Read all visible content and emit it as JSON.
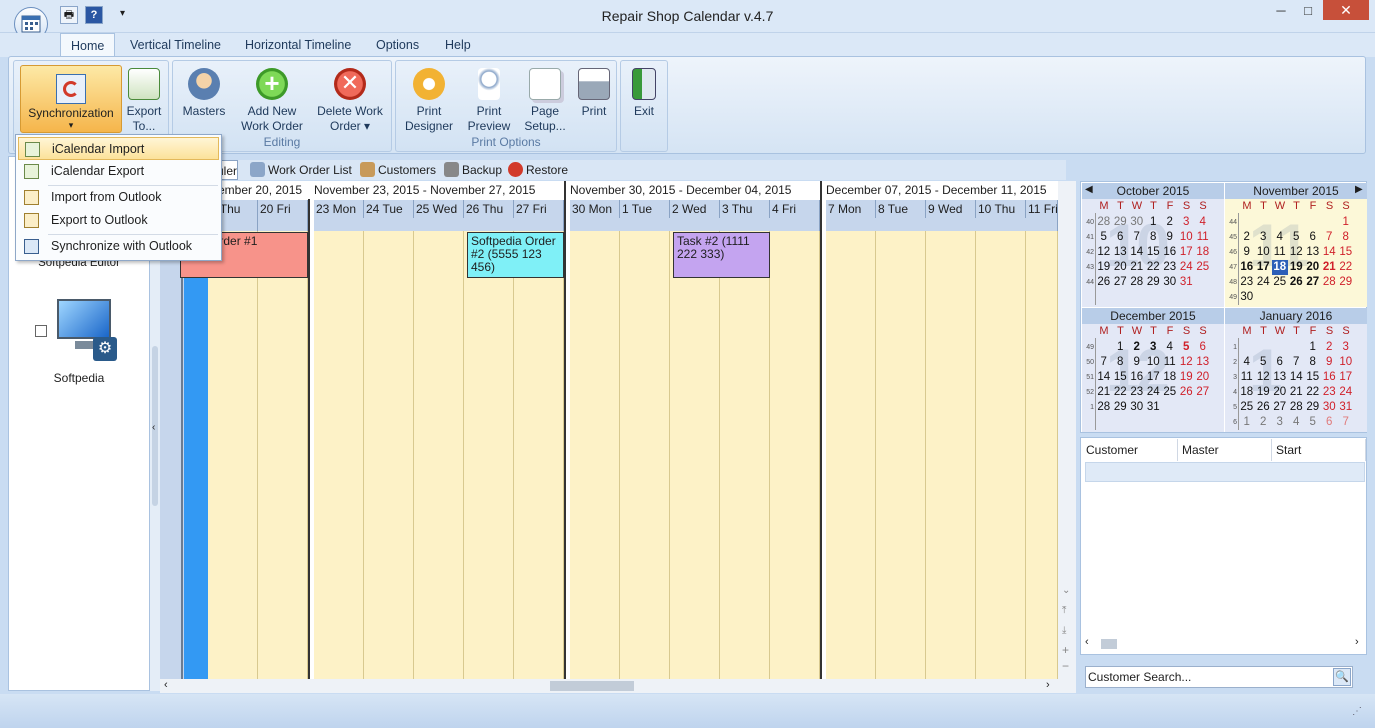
{
  "app": {
    "title": "Repair Shop Calendar v.4.7"
  },
  "window": {
    "minimize": "─",
    "maximize": "□",
    "close": "✕"
  },
  "ribbon_tabs": [
    "Home",
    "Vertical Timeline",
    "Horizontal Timeline",
    "Options",
    "Help"
  ],
  "ribbon": {
    "sync": {
      "label": "Synchronization",
      "arrow": "▾"
    },
    "export": {
      "label1": "Export",
      "label2": "To..."
    },
    "masters": {
      "label": "Masters"
    },
    "add_wo": {
      "label1": "Add New",
      "label2": "Work Order"
    },
    "delete_wo": {
      "label1": "Delete Work",
      "label2": "Order ▾"
    },
    "editing_group": "Editing",
    "print_designer": {
      "label1": "Print",
      "label2": "Designer"
    },
    "print_preview": {
      "label1": "Print",
      "label2": "Preview"
    },
    "page_setup": {
      "label1": "Page",
      "label2": "Setup..."
    },
    "print": {
      "label": "Print"
    },
    "print_group": "Print Options",
    "exit": {
      "label": "Exit"
    }
  },
  "sync_menu": [
    "iCalendar Import",
    "iCalendar Export",
    "Import from Outlook",
    "Export to Outlook",
    "Synchronize with Outlook"
  ],
  "left_panel": {
    "item1": "Softpedia Editor",
    "item2": "Softpedia"
  },
  "page_tabs": [
    "uler",
    "Work Order List",
    "Customers",
    "Backup",
    "Restore"
  ],
  "weeks": [
    {
      "range": "vember 20, 2015",
      "days": [
        "9 Thu",
        "20 Fri"
      ]
    },
    {
      "range": "November 23, 2015 - November 27, 2015",
      "days": [
        "23 Mon",
        "24 Tue",
        "25 Wed",
        "26 Thu",
        "27 Fri"
      ]
    },
    {
      "range": "November 30, 2015 - December 04, 2015",
      "days": [
        "30 Mon",
        "1 Tue",
        "2 Wed",
        "3 Thu",
        "4 Fri"
      ]
    },
    {
      "range": "December 07, 2015 - December 11, 2015",
      "days": [
        "7 Mon",
        "8 Tue",
        "9 Wed",
        "10 Thu",
        "11 Fri"
      ]
    }
  ],
  "appointments": [
    {
      "text": "edia Order #1",
      "color": "#f7938a"
    },
    {
      "text": "Softpedia Order #2 (5555 123 456)",
      "color": "#7ff0f7"
    },
    {
      "text": "Task #2 (1111 222 333)",
      "color": "#c4a4f0"
    }
  ],
  "calendars": [
    {
      "title": "October 2015",
      "big": "10",
      "dow": [
        "M",
        "T",
        "W",
        "T",
        "F",
        "S",
        "S"
      ],
      "weeks": [
        "40",
        "41",
        "42",
        "43",
        "44"
      ],
      "rows": [
        [
          "28",
          "29",
          "30",
          "1",
          "2",
          "3",
          "4"
        ],
        [
          "5",
          "6",
          "7",
          "8",
          "9",
          "10",
          "11"
        ],
        [
          "12",
          "13",
          "14",
          "15",
          "16",
          "17",
          "18"
        ],
        [
          "19",
          "20",
          "21",
          "22",
          "23",
          "24",
          "25"
        ],
        [
          "26",
          "27",
          "28",
          "29",
          "30",
          "31",
          ""
        ]
      ]
    },
    {
      "title": "November 2015",
      "big": "11",
      "dow": [
        "M",
        "T",
        "W",
        "T",
        "F",
        "S",
        "S"
      ],
      "weeks": [
        "44",
        "45",
        "46",
        "47",
        "48",
        "49"
      ],
      "rows": [
        [
          "",
          "",
          "",
          "",
          "",
          "",
          "1"
        ],
        [
          "2",
          "3",
          "4",
          "5",
          "6",
          "7",
          "8"
        ],
        [
          "9",
          "10",
          "11",
          "12",
          "13",
          "14",
          "15"
        ],
        [
          "16",
          "17",
          "18",
          "19",
          "20",
          "21",
          "22"
        ],
        [
          "23",
          "24",
          "25",
          "26",
          "27",
          "28",
          "29"
        ],
        [
          "30",
          "",
          "",
          "",
          "",
          "",
          ""
        ]
      ]
    },
    {
      "title": "December 2015",
      "big": "12",
      "dow": [
        "M",
        "T",
        "W",
        "T",
        "F",
        "S",
        "S"
      ],
      "weeks": [
        "49",
        "50",
        "51",
        "52",
        "1"
      ],
      "rows": [
        [
          "",
          "1",
          "2",
          "3",
          "4",
          "5",
          "6"
        ],
        [
          "7",
          "8",
          "9",
          "10",
          "11",
          "12",
          "13"
        ],
        [
          "14",
          "15",
          "16",
          "17",
          "18",
          "19",
          "20"
        ],
        [
          "21",
          "22",
          "23",
          "24",
          "25",
          "26",
          "27"
        ],
        [
          "28",
          "29",
          "30",
          "31",
          "",
          "",
          ""
        ]
      ]
    },
    {
      "title": "January 2016",
      "big": "1",
      "dow": [
        "M",
        "T",
        "W",
        "T",
        "F",
        "S",
        "S"
      ],
      "weeks": [
        "1",
        "2",
        "3",
        "4",
        "5",
        "6"
      ],
      "rows": [
        [
          "",
          "",
          "",
          "",
          "1",
          "2",
          "3"
        ],
        [
          "4",
          "5",
          "6",
          "7",
          "8",
          "9",
          "10"
        ],
        [
          "11",
          "12",
          "13",
          "14",
          "15",
          "16",
          "17"
        ],
        [
          "18",
          "19",
          "20",
          "21",
          "22",
          "23",
          "24"
        ],
        [
          "25",
          "26",
          "27",
          "28",
          "29",
          "30",
          "31"
        ],
        [
          "1",
          "2",
          "3",
          "4",
          "5",
          "6",
          "7"
        ]
      ]
    }
  ],
  "grid_columns": [
    "Customer",
    "Master",
    "Start"
  ],
  "customer_search": "Customer Search..."
}
